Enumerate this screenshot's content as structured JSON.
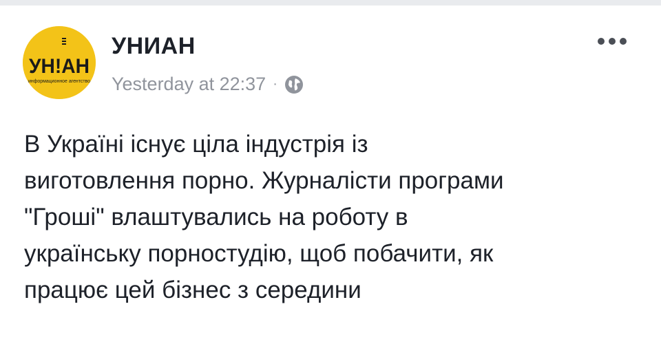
{
  "post": {
    "author": "УНИАН",
    "timestamp": "Yesterday at 22:37",
    "separator": "·",
    "privacy_icon": "globe-icon",
    "menu_icon": "more-options-icon",
    "text": "В Україні існує ціла індустрія із\nвиготовлення порно. Журналісти програми\n\"Гроші\" влаштувались на роботу в\nукраїнську порностудію, щоб побачити, як\nпрацює цей бізнес з середини"
  },
  "avatar": {
    "logo_text": "УН!АН",
    "tagline": "информационное агентство",
    "colors": {
      "background": "#f3c318",
      "text": "#1a1a1a"
    }
  },
  "colors": {
    "name_text": "#1d2129",
    "meta_text": "#90949c",
    "body_text": "#1d2129",
    "page_background": "#ffffff",
    "feed_background": "#e9ebee"
  }
}
